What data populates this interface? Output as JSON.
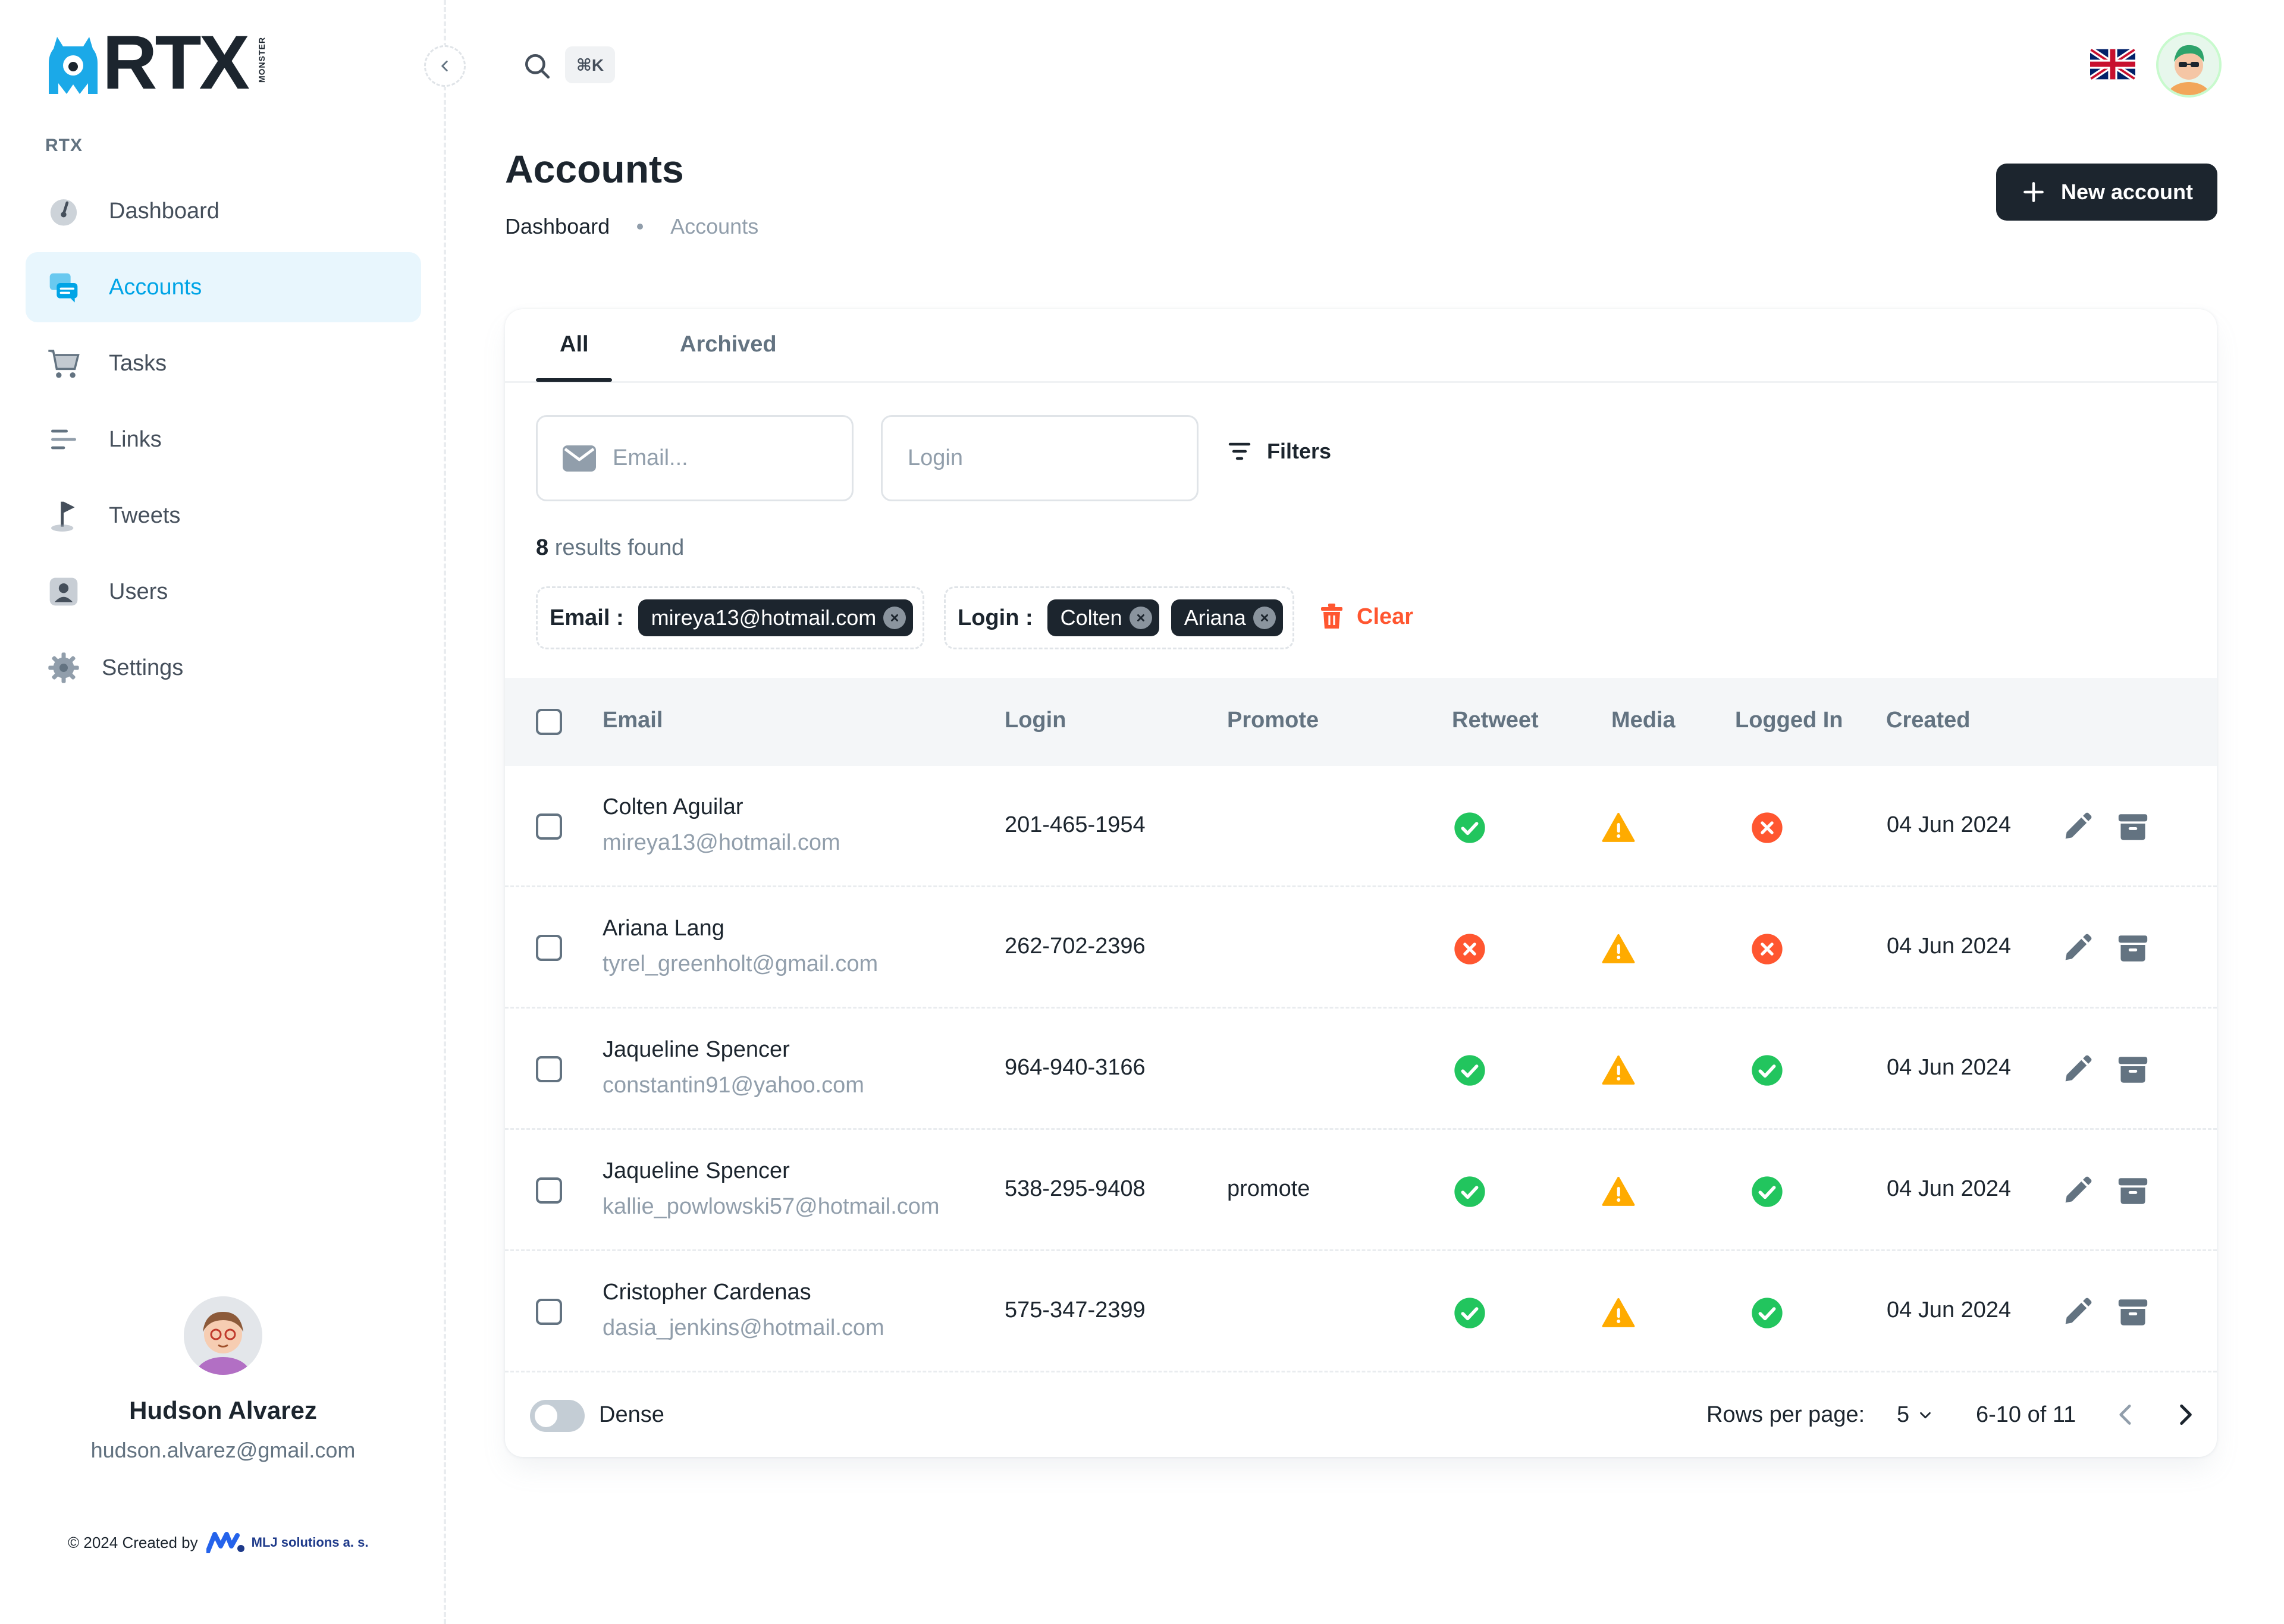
{
  "brand": {
    "name": "RTX",
    "tagline": "MONSTER"
  },
  "sidebar": {
    "section_label": "RTX",
    "items": [
      {
        "label": "Dashboard",
        "icon": "dashboard-gauge-icon",
        "active": false
      },
      {
        "label": "Accounts",
        "icon": "chat-bubbles-icon",
        "active": true
      },
      {
        "label": "Tasks",
        "icon": "cart-icon",
        "active": false
      },
      {
        "label": "Links",
        "icon": "align-left-icon",
        "active": false
      },
      {
        "label": "Tweets",
        "icon": "flag-icon",
        "active": false
      },
      {
        "label": "Users",
        "icon": "user-icon",
        "active": false
      },
      {
        "label": "Settings",
        "icon": "gear-icon",
        "active": false
      }
    ],
    "profile": {
      "name": "Hudson Alvarez",
      "email": "hudson.alvarez@gmail.com"
    },
    "credit": {
      "text": "© 2024 Created by",
      "brand": "MLJ solutions a. s."
    }
  },
  "header": {
    "search_shortcut": "⌘K",
    "language": "en-GB"
  },
  "page": {
    "title": "Accounts",
    "breadcrumb": [
      "Dashboard",
      "Accounts"
    ],
    "new_button": "New account"
  },
  "tabs": [
    {
      "label": "All",
      "active": true
    },
    {
      "label": "Archived",
      "active": false
    }
  ],
  "filters": {
    "email_placeholder": "Email...",
    "login_placeholder": "Login",
    "filters_label": "Filters",
    "results_count": "8",
    "results_text": "results found",
    "email_label": "Email :",
    "email_chips": [
      "mireya13@hotmail.com"
    ],
    "login_label": "Login :",
    "login_chips": [
      "Colten",
      "Ariana"
    ],
    "clear_label": "Clear"
  },
  "table": {
    "columns": [
      "Email",
      "Login",
      "Promote",
      "Retweet",
      "Media",
      "Logged In",
      "Created"
    ],
    "rows": [
      {
        "name": "Colten Aguilar",
        "email": "mireya13@hotmail.com",
        "login": "201-465-1954",
        "promote": "",
        "retweet": "ok",
        "media": "warn",
        "logged_in": "error",
        "created": "04 Jun 2024"
      },
      {
        "name": "Ariana Lang",
        "email": "tyrel_greenholt@gmail.com",
        "login": "262-702-2396",
        "promote": "",
        "retweet": "error",
        "media": "warn",
        "logged_in": "error",
        "created": "04 Jun 2024"
      },
      {
        "name": "Jaqueline Spencer",
        "email": "constantin91@yahoo.com",
        "login": "964-940-3166",
        "promote": "",
        "retweet": "ok",
        "media": "warn",
        "logged_in": "ok",
        "created": "04 Jun 2024"
      },
      {
        "name": "Jaqueline Spencer",
        "email": "kallie_powlowski57@hotmail.com",
        "login": "538-295-9408",
        "promote": "promote",
        "retweet": "ok",
        "media": "warn",
        "logged_in": "ok",
        "created": "04 Jun 2024"
      },
      {
        "name": "Cristopher Cardenas",
        "email": "dasia_jenkins@hotmail.com",
        "login": "575-347-2399",
        "promote": "",
        "retweet": "ok",
        "media": "warn",
        "logged_in": "ok",
        "created": "04 Jun 2024"
      }
    ]
  },
  "footer": {
    "dense_label": "Dense",
    "dense_on": false,
    "rows_per_page_label": "Rows per page:",
    "rows_per_page": "5",
    "range": "6-10 of 11"
  },
  "colors": {
    "accent": "#00a4e6",
    "ok": "#22c55e",
    "warn": "#ffab00",
    "error": "#ff5630",
    "dark": "#1c252e"
  }
}
